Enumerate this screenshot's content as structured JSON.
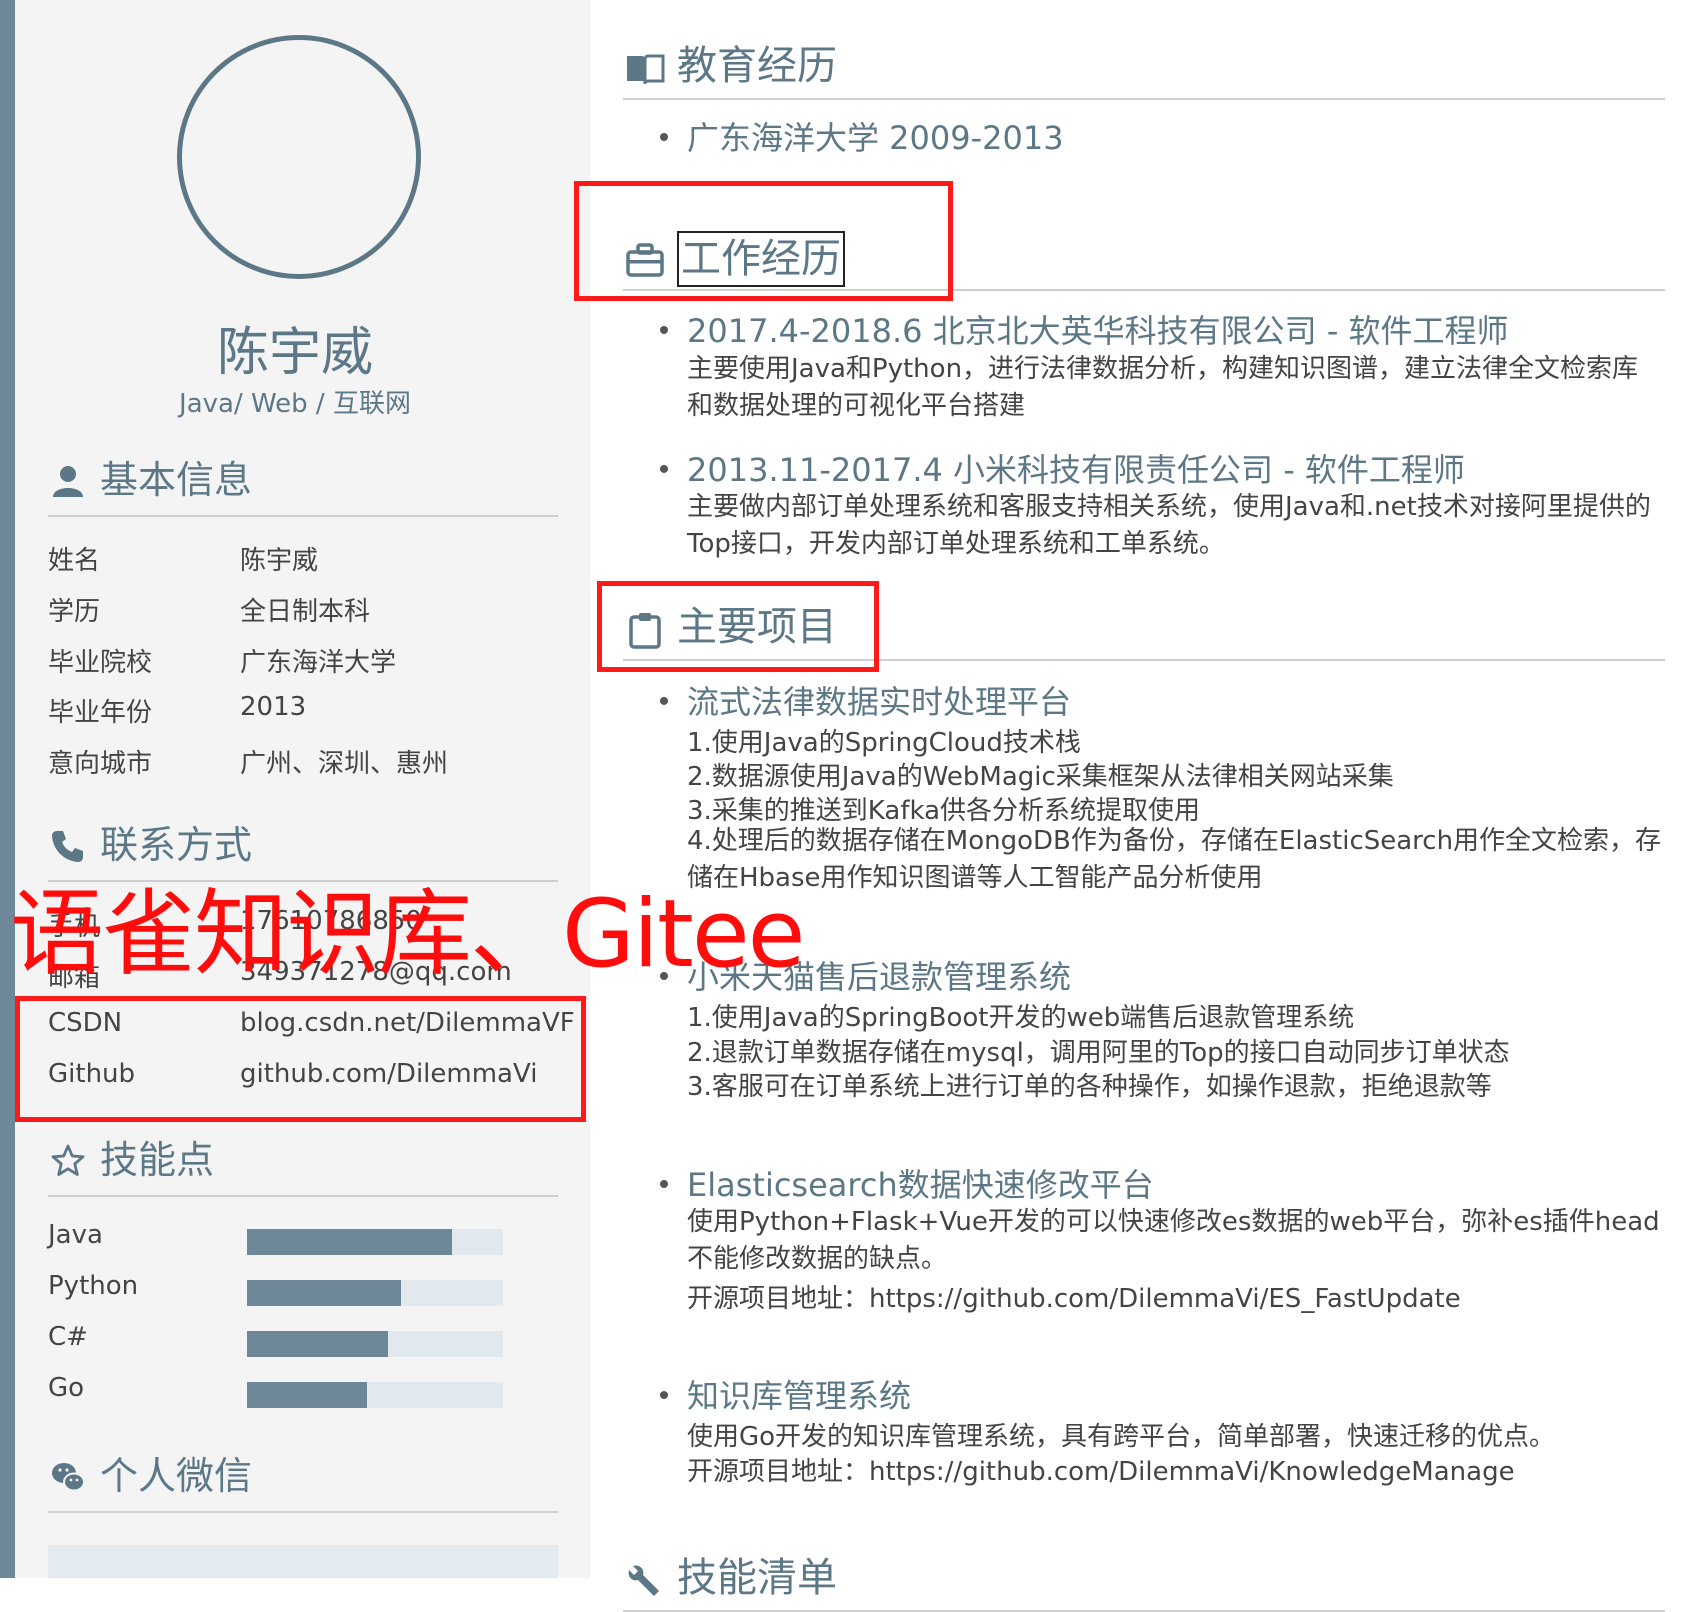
{
  "profile": {
    "name": "陈宇威",
    "subtitle": "Java/ Web / 互联网"
  },
  "sections": {
    "basic_info": "基本信息",
    "contact": "联系方式",
    "skills": "技能点",
    "wechat": "个人微信",
    "education": "教育经历",
    "work": "工作经历",
    "projects": "主要项目",
    "skill_list": "技能清单"
  },
  "basic_info": [
    {
      "k": "姓名",
      "v": "陈宇威"
    },
    {
      "k": "学历",
      "v": "全日制本科"
    },
    {
      "k": "毕业院校",
      "v": "广东海洋大学"
    },
    {
      "k": "毕业年份",
      "v": "2013"
    },
    {
      "k": "意向城市",
      "v": "广州、深圳、惠州"
    }
  ],
  "contact": [
    {
      "k": "手机",
      "v": "17610786850"
    },
    {
      "k": "邮箱",
      "v": "349371278@qq.com"
    },
    {
      "k": "CSDN",
      "v": "blog.csdn.net/DilemmaVF"
    },
    {
      "k": "Github",
      "v": "github.com/DilemmaVi"
    }
  ],
  "skills": [
    {
      "name": "Java",
      "level": 0.8
    },
    {
      "name": "Python",
      "level": 0.6
    },
    {
      "name": "C#",
      "level": 0.55
    },
    {
      "name": "Go",
      "level": 0.47
    }
  ],
  "education": {
    "item": "广东海洋大学 2009-2013"
  },
  "work": [
    {
      "title": "2017.4-2018.6 北京北大英华科技有限公司 - 软件工程师",
      "desc": "主要使用Java和Python，进行法律数据分析，构建知识图谱，建立法律全文检索库和数据处理的可视化平台搭建"
    },
    {
      "title": "2013.11-2017.4 小米科技有限责任公司 - 软件工程师",
      "desc": "主要做内部订单处理系统和客服支持相关系统，使用Java和.net技术对接阿里提供的Top接口，开发内部订单处理系统和工单系统。"
    }
  ],
  "projects": [
    {
      "title": " 流式法律数据实时处理平台",
      "lines": [
        "1.使用Java的SpringCloud技术栈",
        "2.数据源使用Java的WebMagic采集框架从法律相关网站采集",
        "3.采集的推送到Kafka供各分析系统提取使用"
      ],
      "para": "4.处理后的数据存储在MongoDB作为备份，存储在ElasticSearch用作全文检索，存储在Hbase用作知识图谱等人工智能产品分析使用"
    },
    {
      "title": "小米天猫售后退款管理系统",
      "lines": [
        "1.使用Java的SpringBoot开发的web端售后退款管理系统",
        "2.退款订单数据存储在mysql，调用阿里的Top的接口自动同步订单状态",
        "3.客服可在订单系统上进行订单的各种操作，如操作退款，拒绝退款等"
      ]
    },
    {
      "title": "Elasticsearch数据快速修改平台",
      "para": "使用Python+Flask+Vue开发的可以快速修改es数据的web平台，弥补es插件head不能修改数据的缺点。",
      "lines": [
        "开源项目地址：https://github.com/DilemmaVi/ES_FastUpdate"
      ]
    },
    {
      "title": "知识库管理系统",
      "lines": [
        "使用Go开发的知识库管理系统，具有跨平台，简单部署，快速迁移的优点。",
        "开源项目地址：https://github.com/DilemmaVi/KnowledgeManage"
      ]
    }
  ],
  "annotation": {
    "text": "语雀知识库、Gitee",
    "color": "#ff0d0d"
  },
  "colors": {
    "accent": "#5c7786",
    "bar": "#6e8799",
    "bar_track": "#e1e8ee",
    "sidebar": "#f4f4f4",
    "highlight": "#ff1a1a"
  }
}
